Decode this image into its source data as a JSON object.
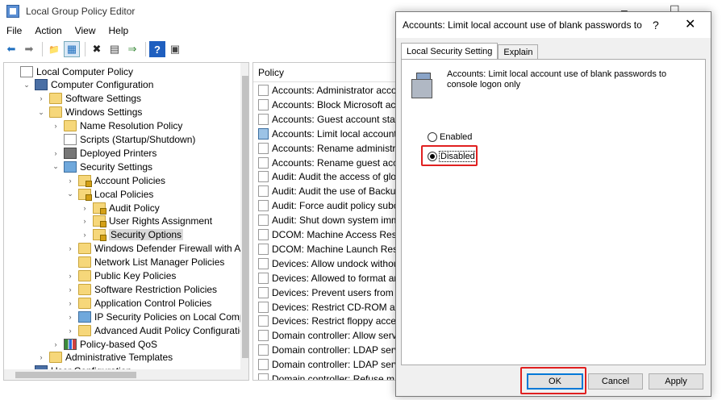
{
  "window": {
    "title": "Local Group Policy Editor",
    "icon": "policy-editor-icon",
    "controls": {
      "minimize": "–",
      "maximize": "☐"
    }
  },
  "menu": [
    "File",
    "Action",
    "View",
    "Help"
  ],
  "toolbar": {
    "icons": [
      "back-arrow-icon",
      "forward-arrow-icon",
      "up-folder-icon",
      "show-hide-tree-icon",
      "delete-icon",
      "properties-icon",
      "export-icon",
      "help-icon",
      "view-icon"
    ],
    "glyphs": {
      "back": "⬅",
      "forward": "➡",
      "up": "📁",
      "tree": "▦",
      "delete": "✖",
      "properties": "▤",
      "export": "⇒",
      "help": "?",
      "view": "▣"
    }
  },
  "tree": {
    "items": [
      {
        "label": "Local Computer Policy",
        "indent": 0,
        "chevron": "",
        "icon": "policy-doc"
      },
      {
        "label": "Computer Configuration",
        "indent": 1,
        "chevron": "⌄",
        "icon": "computer"
      },
      {
        "label": "Software Settings",
        "indent": 2,
        "chevron": "›",
        "icon": "folder"
      },
      {
        "label": "Windows Settings",
        "indent": 2,
        "chevron": "⌄",
        "icon": "folder"
      },
      {
        "label": "Name Resolution Policy",
        "indent": 3,
        "chevron": "›",
        "icon": "folder"
      },
      {
        "label": "Scripts (Startup/Shutdown)",
        "indent": 3,
        "chevron": "",
        "icon": "policy-doc"
      },
      {
        "label": "Deployed Printers",
        "indent": 3,
        "chevron": "›",
        "icon": "printer"
      },
      {
        "label": "Security Settings",
        "indent": 3,
        "chevron": "⌄",
        "icon": "shield"
      },
      {
        "label": "Account Policies",
        "indent": 4,
        "chevron": "›",
        "icon": "folder-lock"
      },
      {
        "label": "Local Policies",
        "indent": 4,
        "chevron": "⌄",
        "icon": "folder-lock"
      },
      {
        "label": "Audit Policy",
        "indent": 5,
        "chevron": "›",
        "icon": "folder-lock"
      },
      {
        "label": "User Rights Assignment",
        "indent": 5,
        "chevron": "›",
        "icon": "folder-lock"
      },
      {
        "label": "Security Options",
        "indent": 5,
        "chevron": "›",
        "icon": "folder-lock",
        "selected": true
      },
      {
        "label": "Windows Defender Firewall with Advanc",
        "indent": 4,
        "chevron": "›",
        "icon": "folder"
      },
      {
        "label": "Network List Manager Policies",
        "indent": 4,
        "chevron": "",
        "icon": "folder"
      },
      {
        "label": "Public Key Policies",
        "indent": 4,
        "chevron": "›",
        "icon": "folder"
      },
      {
        "label": "Software Restriction Policies",
        "indent": 4,
        "chevron": "›",
        "icon": "folder"
      },
      {
        "label": "Application Control Policies",
        "indent": 4,
        "chevron": "›",
        "icon": "folder"
      },
      {
        "label": "IP Security Policies on Local Computer",
        "indent": 4,
        "chevron": "›",
        "icon": "shield"
      },
      {
        "label": "Advanced Audit Policy Configuration",
        "indent": 4,
        "chevron": "›",
        "icon": "folder"
      },
      {
        "label": "Policy-based QoS",
        "indent": 3,
        "chevron": "›",
        "icon": "chart-ico"
      },
      {
        "label": "Administrative Templates",
        "indent": 2,
        "chevron": "›",
        "icon": "folder"
      },
      {
        "label": "User Configuration",
        "indent": 1,
        "chevron": "›",
        "icon": "computer"
      }
    ]
  },
  "list": {
    "header": "Policy",
    "rows": [
      {
        "label": "Accounts: Administrator account status"
      },
      {
        "label": "Accounts: Block Microsoft accounts"
      },
      {
        "label": "Accounts: Guest account status"
      },
      {
        "label": "Accounts: Limit local account use of blank passwords",
        "selected": true
      },
      {
        "label": "Accounts: Rename administrator account"
      },
      {
        "label": "Accounts: Rename guest account"
      },
      {
        "label": "Audit: Audit the access of global system objects"
      },
      {
        "label": "Audit: Audit the use of Backup and Restore privilege"
      },
      {
        "label": "Audit: Force audit policy subcategory settings"
      },
      {
        "label": "Audit: Shut down system immediately"
      },
      {
        "label": "DCOM: Machine Access Restrictions"
      },
      {
        "label": "DCOM: Machine Launch Restrictions"
      },
      {
        "label": "Devices: Allow undock without having to log on"
      },
      {
        "label": "Devices: Allowed to format and eject"
      },
      {
        "label": "Devices: Prevent users from installing printer drivers"
      },
      {
        "label": "Devices: Restrict CD-ROM access"
      },
      {
        "label": "Devices: Restrict floppy access to locally logged-on user"
      },
      {
        "label": "Domain controller: Allow server operators"
      },
      {
        "label": "Domain controller: LDAP server channel binding"
      },
      {
        "label": "Domain controller: LDAP server signing"
      },
      {
        "label": "Domain controller: Refuse machine account password changes"
      }
    ]
  },
  "dialog": {
    "title": "Accounts: Limit local account use of blank passwords to c...",
    "help": "?",
    "close": "✕",
    "tabs": {
      "active": "Local Security Setting",
      "inactive": "Explain"
    },
    "description": "Accounts: Limit local account use of blank passwords to console logon only",
    "options": {
      "enabled": {
        "label": "Enabled",
        "checked": false
      },
      "disabled": {
        "label": "Disabled",
        "checked": true
      }
    },
    "buttons": {
      "ok": "OK",
      "cancel": "Cancel",
      "apply": "Apply"
    },
    "highlight_color": "#e02020"
  }
}
